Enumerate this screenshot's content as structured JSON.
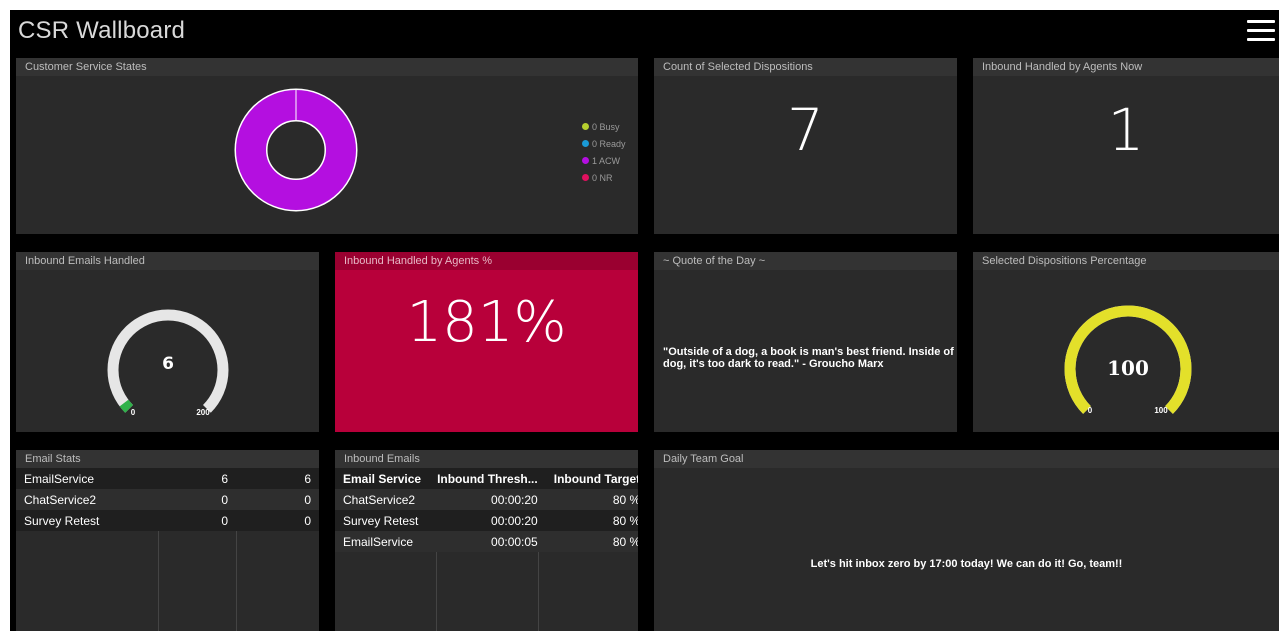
{
  "app": {
    "title": "CSR Wallboard",
    "menu_icon": "hamburger-menu-icon"
  },
  "panels": {
    "cs_states": {
      "title": "Customer Service States",
      "legend": [
        {
          "label": "0 Busy",
          "value": 0,
          "color": "#b6cf2e"
        },
        {
          "label": "0 Ready",
          "value": 0,
          "color": "#1a9ad6"
        },
        {
          "label": "1 ACW",
          "value": 1,
          "color": "#b40fe0"
        },
        {
          "label": "0 NR",
          "value": 0,
          "color": "#e0105e"
        }
      ],
      "donut_color": "#b40fe0"
    },
    "count_dispositions": {
      "title": "Count of Selected Dispositions",
      "value": "7"
    },
    "inbound_now": {
      "title": "Inbound Handled by Agents Now",
      "value": "1"
    },
    "emails_handled": {
      "title": "Inbound Emails Handled",
      "value": "6",
      "min": "0",
      "max": "200",
      "fraction": 0.03,
      "fill_color": "#2fb24a",
      "track_color": "#e6e6e6"
    },
    "handled_pct": {
      "title": "Inbound Handled by Agents %",
      "value": "181%",
      "bg_color": "#b8003a",
      "header_color": "#9a0030"
    },
    "quote": {
      "title": "~ Quote of the Day ~",
      "text": "\"Outside of a dog, a book is man's best friend. Inside of a dog, it's too dark to read.\" - Groucho Marx"
    },
    "dispositions_pct": {
      "title": "Selected Dispositions Percentage",
      "value": "100",
      "min": "0",
      "max": "100",
      "fraction": 1.0,
      "fill_color": "#e3e02a"
    },
    "email_stats": {
      "title": "Email Stats",
      "rows": [
        {
          "name": "EmailService",
          "a": "6",
          "b": "6"
        },
        {
          "name": "ChatService2",
          "a": "0",
          "b": "0"
        },
        {
          "name": "Survey Retest",
          "a": "0",
          "b": "0"
        }
      ]
    },
    "inbound_emails": {
      "title": "Inbound Emails",
      "columns": [
        "Email Service",
        "Inbound Thresh...",
        "Inbound Target"
      ],
      "rows": [
        {
          "service": "ChatService2",
          "threshold": "00:00:20",
          "target": "80 %"
        },
        {
          "service": "Survey Retest",
          "threshold": "00:00:20",
          "target": "80 %"
        },
        {
          "service": "EmailService",
          "threshold": "00:00:05",
          "target": "80 %"
        }
      ]
    },
    "daily_goal": {
      "title": "Daily Team Goal",
      "text": "Let's hit inbox zero by 17:00 today! We can do it! Go, team!!"
    }
  }
}
